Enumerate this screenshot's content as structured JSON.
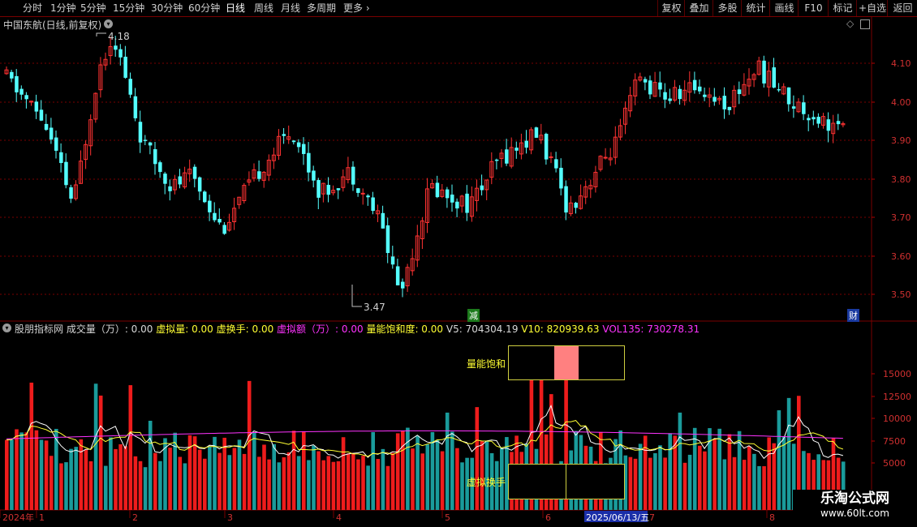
{
  "toolbar": {
    "periods": [
      "分时",
      "1分钟",
      "5分钟",
      "15分钟",
      "30分钟",
      "60分钟",
      "日线",
      "周线",
      "月线",
      "多周期",
      "更多"
    ],
    "active_period": "日线",
    "right_buttons": [
      "复权",
      "叠加",
      "多股",
      "统计",
      "画线",
      "F10",
      "标记",
      "+自选",
      "返回"
    ]
  },
  "main": {
    "title": "中国东航(日线,前复权)",
    "high_label": "4.18",
    "low_label": "3.47",
    "price_axis": [
      "4.10",
      "4.00",
      "3.90",
      "3.80",
      "3.70",
      "3.60",
      "3.50"
    ],
    "badge_reduce": "减",
    "badge_finance": "财"
  },
  "indicator": {
    "title": "股朋指标网",
    "items": [
      {
        "text": "成交量（万）: 0.00",
        "color": "#d8d8d8"
      },
      {
        "text": "虚拟量: 0.00",
        "color": "#ffff33"
      },
      {
        "text": "虚换手: 0.00",
        "color": "#ffff33"
      },
      {
        "text": "虚拟额（万）: 0.00",
        "color": "#ff33ff"
      },
      {
        "text": "量能饱和度: 0.00",
        "color": "#ffff33"
      },
      {
        "text": "V5: 704304.19",
        "color": "#d8d8d8"
      },
      {
        "text": "V10: 820939.63",
        "color": "#ffff33"
      },
      {
        "text": "VOL135: 730278.31",
        "color": "#ff33ff"
      }
    ],
    "vol_axis": [
      "15000",
      "12500",
      "10000",
      "7500",
      "5000"
    ],
    "box1_label": "量能饱和",
    "box2_label": "虚拟换手"
  },
  "date_axis": {
    "labels": [
      "2024年",
      "1",
      "2",
      "3",
      "4",
      "5",
      "6",
      "7",
      "8"
    ],
    "cursor_date": "2025/06/13/五"
  },
  "watermark": {
    "line1": "乐淘公式网",
    "line2": "www.60lt.com"
  },
  "colors": {
    "up": "#ff3232",
    "down": "#54ffff",
    "vol_up": "#ee1c1c",
    "vol_down": "#1a9b9b",
    "grid": "#7a0000",
    "v5": "#ffffff",
    "v10": "#ffff33",
    "vol135": "#ff33ff"
  }
}
